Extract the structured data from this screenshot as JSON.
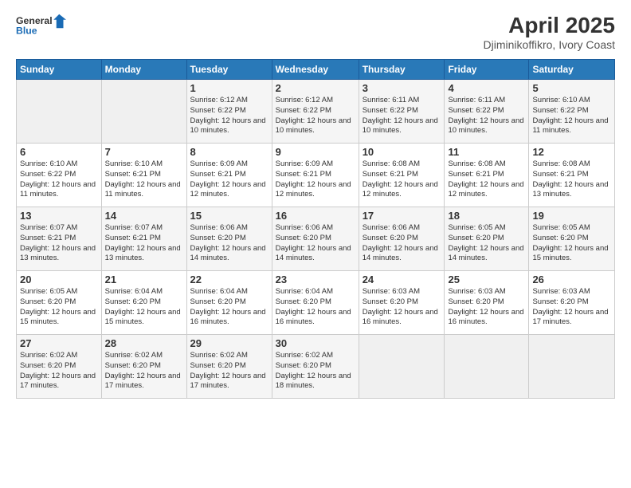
{
  "header": {
    "logo_line1": "General",
    "logo_line2": "Blue",
    "title": "April 2025",
    "subtitle": "Djiminikoffikro, Ivory Coast"
  },
  "days_of_week": [
    "Sunday",
    "Monday",
    "Tuesday",
    "Wednesday",
    "Thursday",
    "Friday",
    "Saturday"
  ],
  "weeks": [
    [
      {
        "day": "",
        "info": ""
      },
      {
        "day": "",
        "info": ""
      },
      {
        "day": "1",
        "info": "Sunrise: 6:12 AM\nSunset: 6:22 PM\nDaylight: 12 hours and 10 minutes."
      },
      {
        "day": "2",
        "info": "Sunrise: 6:12 AM\nSunset: 6:22 PM\nDaylight: 12 hours and 10 minutes."
      },
      {
        "day": "3",
        "info": "Sunrise: 6:11 AM\nSunset: 6:22 PM\nDaylight: 12 hours and 10 minutes."
      },
      {
        "day": "4",
        "info": "Sunrise: 6:11 AM\nSunset: 6:22 PM\nDaylight: 12 hours and 10 minutes."
      },
      {
        "day": "5",
        "info": "Sunrise: 6:10 AM\nSunset: 6:22 PM\nDaylight: 12 hours and 11 minutes."
      }
    ],
    [
      {
        "day": "6",
        "info": "Sunrise: 6:10 AM\nSunset: 6:22 PM\nDaylight: 12 hours and 11 minutes."
      },
      {
        "day": "7",
        "info": "Sunrise: 6:10 AM\nSunset: 6:21 PM\nDaylight: 12 hours and 11 minutes."
      },
      {
        "day": "8",
        "info": "Sunrise: 6:09 AM\nSunset: 6:21 PM\nDaylight: 12 hours and 12 minutes."
      },
      {
        "day": "9",
        "info": "Sunrise: 6:09 AM\nSunset: 6:21 PM\nDaylight: 12 hours and 12 minutes."
      },
      {
        "day": "10",
        "info": "Sunrise: 6:08 AM\nSunset: 6:21 PM\nDaylight: 12 hours and 12 minutes."
      },
      {
        "day": "11",
        "info": "Sunrise: 6:08 AM\nSunset: 6:21 PM\nDaylight: 12 hours and 12 minutes."
      },
      {
        "day": "12",
        "info": "Sunrise: 6:08 AM\nSunset: 6:21 PM\nDaylight: 12 hours and 13 minutes."
      }
    ],
    [
      {
        "day": "13",
        "info": "Sunrise: 6:07 AM\nSunset: 6:21 PM\nDaylight: 12 hours and 13 minutes."
      },
      {
        "day": "14",
        "info": "Sunrise: 6:07 AM\nSunset: 6:21 PM\nDaylight: 12 hours and 13 minutes."
      },
      {
        "day": "15",
        "info": "Sunrise: 6:06 AM\nSunset: 6:20 PM\nDaylight: 12 hours and 14 minutes."
      },
      {
        "day": "16",
        "info": "Sunrise: 6:06 AM\nSunset: 6:20 PM\nDaylight: 12 hours and 14 minutes."
      },
      {
        "day": "17",
        "info": "Sunrise: 6:06 AM\nSunset: 6:20 PM\nDaylight: 12 hours and 14 minutes."
      },
      {
        "day": "18",
        "info": "Sunrise: 6:05 AM\nSunset: 6:20 PM\nDaylight: 12 hours and 14 minutes."
      },
      {
        "day": "19",
        "info": "Sunrise: 6:05 AM\nSunset: 6:20 PM\nDaylight: 12 hours and 15 minutes."
      }
    ],
    [
      {
        "day": "20",
        "info": "Sunrise: 6:05 AM\nSunset: 6:20 PM\nDaylight: 12 hours and 15 minutes."
      },
      {
        "day": "21",
        "info": "Sunrise: 6:04 AM\nSunset: 6:20 PM\nDaylight: 12 hours and 15 minutes."
      },
      {
        "day": "22",
        "info": "Sunrise: 6:04 AM\nSunset: 6:20 PM\nDaylight: 12 hours and 16 minutes."
      },
      {
        "day": "23",
        "info": "Sunrise: 6:04 AM\nSunset: 6:20 PM\nDaylight: 12 hours and 16 minutes."
      },
      {
        "day": "24",
        "info": "Sunrise: 6:03 AM\nSunset: 6:20 PM\nDaylight: 12 hours and 16 minutes."
      },
      {
        "day": "25",
        "info": "Sunrise: 6:03 AM\nSunset: 6:20 PM\nDaylight: 12 hours and 16 minutes."
      },
      {
        "day": "26",
        "info": "Sunrise: 6:03 AM\nSunset: 6:20 PM\nDaylight: 12 hours and 17 minutes."
      }
    ],
    [
      {
        "day": "27",
        "info": "Sunrise: 6:02 AM\nSunset: 6:20 PM\nDaylight: 12 hours and 17 minutes."
      },
      {
        "day": "28",
        "info": "Sunrise: 6:02 AM\nSunset: 6:20 PM\nDaylight: 12 hours and 17 minutes."
      },
      {
        "day": "29",
        "info": "Sunrise: 6:02 AM\nSunset: 6:20 PM\nDaylight: 12 hours and 17 minutes."
      },
      {
        "day": "30",
        "info": "Sunrise: 6:02 AM\nSunset: 6:20 PM\nDaylight: 12 hours and 18 minutes."
      },
      {
        "day": "",
        "info": ""
      },
      {
        "day": "",
        "info": ""
      },
      {
        "day": "",
        "info": ""
      }
    ]
  ]
}
